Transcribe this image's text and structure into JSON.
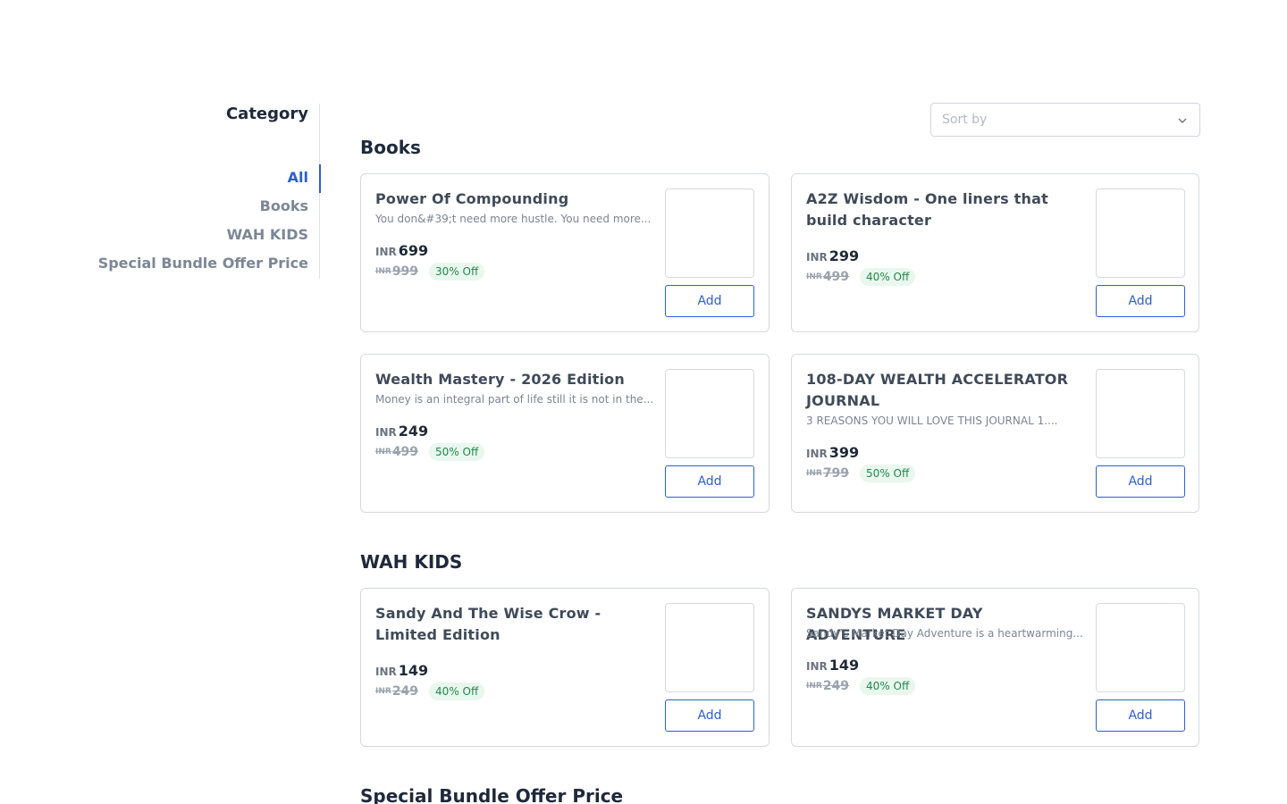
{
  "sidebar": {
    "title": "Category",
    "items": [
      {
        "label": "All",
        "active": true
      },
      {
        "label": "Books",
        "active": false
      },
      {
        "label": "WAH KIDS",
        "active": false
      },
      {
        "label": "Special Bundle Offer Price",
        "active": false
      }
    ]
  },
  "sort": {
    "placeholder": "Sort by",
    "icon": "chevron-down-icon"
  },
  "colors": {
    "accent": "#2d5fd5",
    "discount_bg": "#e9f7ee",
    "discount_text": "#1f8a4a"
  },
  "sections": [
    {
      "title": "Books",
      "products": [
        {
          "title": "Power Of Compounding",
          "description": "You don&#39;t need more hustle. You need more...",
          "currency": "INR",
          "price": "699",
          "mrp": "999",
          "discount": "30% Off",
          "button": "Add"
        },
        {
          "title": "A2Z Wisdom - One liners that build character",
          "description": "",
          "currency": "INR",
          "price": "299",
          "mrp": "499",
          "discount": "40% Off",
          "button": "Add"
        },
        {
          "title": "Wealth Mastery - 2026 Edition",
          "description": "Money is an integral part of life still it is not in the...",
          "currency": "INR",
          "price": "249",
          "mrp": "499",
          "discount": "50% Off",
          "button": "Add"
        },
        {
          "title": "108-DAY WEALTH ACCELERATOR JOURNAL",
          "description": "3 REASONS YOU WILL LOVE THIS JOURNAL 1....",
          "currency": "INR",
          "price": "399",
          "mrp": "799",
          "discount": "50% Off",
          "button": "Add"
        }
      ]
    },
    {
      "title": "WAH KIDS",
      "products": [
        {
          "title": "Sandy And The Wise Crow - Limited Edition",
          "description": "",
          "currency": "INR",
          "price": "149",
          "mrp": "249",
          "discount": "40% Off",
          "button": "Add"
        },
        {
          "title": "SANDYS MARKET DAY ADVENTURE",
          "description": "Sandy’s Market Day Adventure is a heartwarming...",
          "currency": "INR",
          "price": "149",
          "mrp": "249",
          "discount": "40% Off",
          "button": "Add"
        }
      ]
    },
    {
      "title": "Special Bundle Offer Price",
      "products": []
    }
  ]
}
